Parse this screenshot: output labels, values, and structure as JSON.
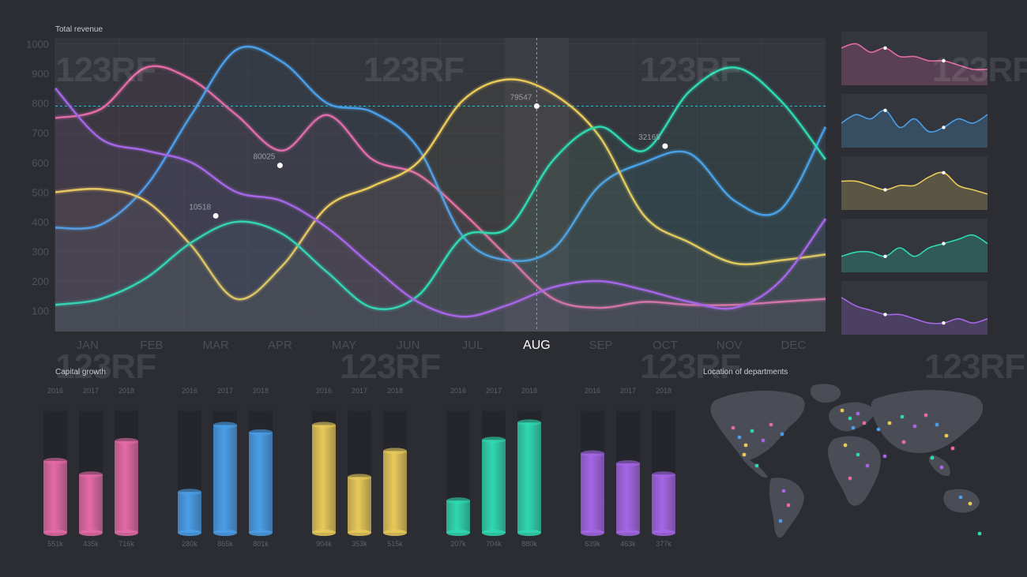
{
  "titles": {
    "revenue": "Total revenue",
    "growth": "Capital growth",
    "map": "Location of departments"
  },
  "watermark": "123RF",
  "colors": {
    "background": "#2b2d33",
    "panel": "#33363d",
    "grid": "#3a3d44",
    "crosshair": "#2fc7d6",
    "pink": "#e46aa6",
    "blue": "#4a9ee8",
    "yellow": "#e8c95a",
    "teal": "#2fd8b0",
    "violet": "#a566e6",
    "map": "#4a4d55"
  },
  "chart_data": [
    {
      "type": "line",
      "title": "Total revenue",
      "x": [
        "JAN",
        "FEB",
        "MAR",
        "APR",
        "MAY",
        "JUN",
        "JUL",
        "AUG",
        "SEP",
        "OCT",
        "NOV",
        "DEC"
      ],
      "highlighted_x": "AUG",
      "yticks": [
        100,
        200,
        300,
        400,
        500,
        600,
        700,
        800,
        900,
        1000
      ],
      "ylim": [
        30,
        1020
      ],
      "crosshair": {
        "x": "AUG",
        "y": 790
      },
      "grid": true,
      "series": [
        {
          "color": "#e46aa6",
          "values": [
            750,
            780,
            920,
            880,
            760,
            640,
            760,
            610,
            560,
            430,
            280,
            140,
            110,
            130,
            120,
            120,
            130,
            140
          ]
        },
        {
          "color": "#4a9ee8",
          "values": [
            380,
            390,
            520,
            760,
            980,
            940,
            800,
            770,
            650,
            350,
            270,
            310,
            520,
            600,
            630,
            470,
            440,
            720
          ]
        },
        {
          "color": "#e8c95a",
          "values": [
            500,
            510,
            470,
            320,
            140,
            250,
            450,
            520,
            600,
            810,
            880,
            830,
            690,
            420,
            330,
            260,
            270,
            290
          ]
        },
        {
          "color": "#2fd8b0",
          "values": [
            120,
            140,
            210,
            330,
            400,
            360,
            230,
            110,
            150,
            350,
            380,
            610,
            720,
            640,
            840,
            920,
            810,
            610
          ]
        },
        {
          "color": "#a566e6",
          "values": [
            850,
            680,
            640,
            600,
            500,
            470,
            380,
            250,
            130,
            80,
            120,
            180,
            200,
            170,
            130,
            110,
            200,
            410
          ]
        }
      ],
      "point_labels": [
        {
          "text": "79547",
          "x": "AUG",
          "y": 790
        },
        {
          "text": "80025",
          "x": "APR",
          "y": 590
        },
        {
          "text": "10518",
          "x": "MAR",
          "y": 420
        },
        {
          "text": "32165",
          "x": "OCT",
          "y": 655
        }
      ]
    },
    {
      "type": "area",
      "small_multiples": true,
      "series": [
        {
          "color": "#e46aa6",
          "values": [
            8,
            9,
            7,
            8,
            6,
            6,
            5,
            5,
            4,
            3,
            3
          ]
        },
        {
          "color": "#4a9ee8",
          "values": [
            5,
            7,
            6,
            8,
            4,
            6,
            3,
            4,
            6,
            5,
            7
          ]
        },
        {
          "color": "#e8c95a",
          "values": [
            6,
            6,
            5,
            4,
            5,
            5,
            7,
            8,
            5,
            4,
            3
          ]
        },
        {
          "color": "#2fd8b0",
          "values": [
            3,
            4,
            4,
            3,
            5,
            3,
            5,
            6,
            7,
            8,
            6
          ]
        },
        {
          "color": "#a566e6",
          "values": [
            8,
            6,
            5,
            4,
            4,
            3,
            2,
            2,
            3,
            2,
            3
          ]
        }
      ]
    },
    {
      "type": "bar",
      "title": "Capital growth",
      "groups": [
        {
          "color": "#e46aa6",
          "years": [
            "2016",
            "2017",
            "2018"
          ],
          "values": [
            0.58,
            0.47,
            0.74
          ],
          "labels": [
            "551k",
            "435k",
            "716k"
          ]
        },
        {
          "color": "#4a9ee8",
          "years": [
            "2016",
            "2017",
            "2018"
          ],
          "values": [
            0.33,
            0.87,
            0.81
          ],
          "labels": [
            "280k",
            "865k",
            "801k"
          ]
        },
        {
          "color": "#e8c95a",
          "years": [
            "2016",
            "2017",
            "2018"
          ],
          "values": [
            0.87,
            0.45,
            0.66
          ],
          "labels": [
            "904k",
            "353k",
            "515k"
          ]
        },
        {
          "color": "#2fd8b0",
          "years": [
            "2016",
            "2017",
            "2018"
          ],
          "values": [
            0.26,
            0.75,
            0.89
          ],
          "labels": [
            "207k",
            "704k",
            "880k"
          ]
        },
        {
          "color": "#a566e6",
          "years": [
            "2016",
            "2017",
            "2018"
          ],
          "values": [
            0.64,
            0.56,
            0.47
          ],
          "labels": [
            "639k",
            "463k",
            "377k"
          ]
        }
      ]
    }
  ]
}
